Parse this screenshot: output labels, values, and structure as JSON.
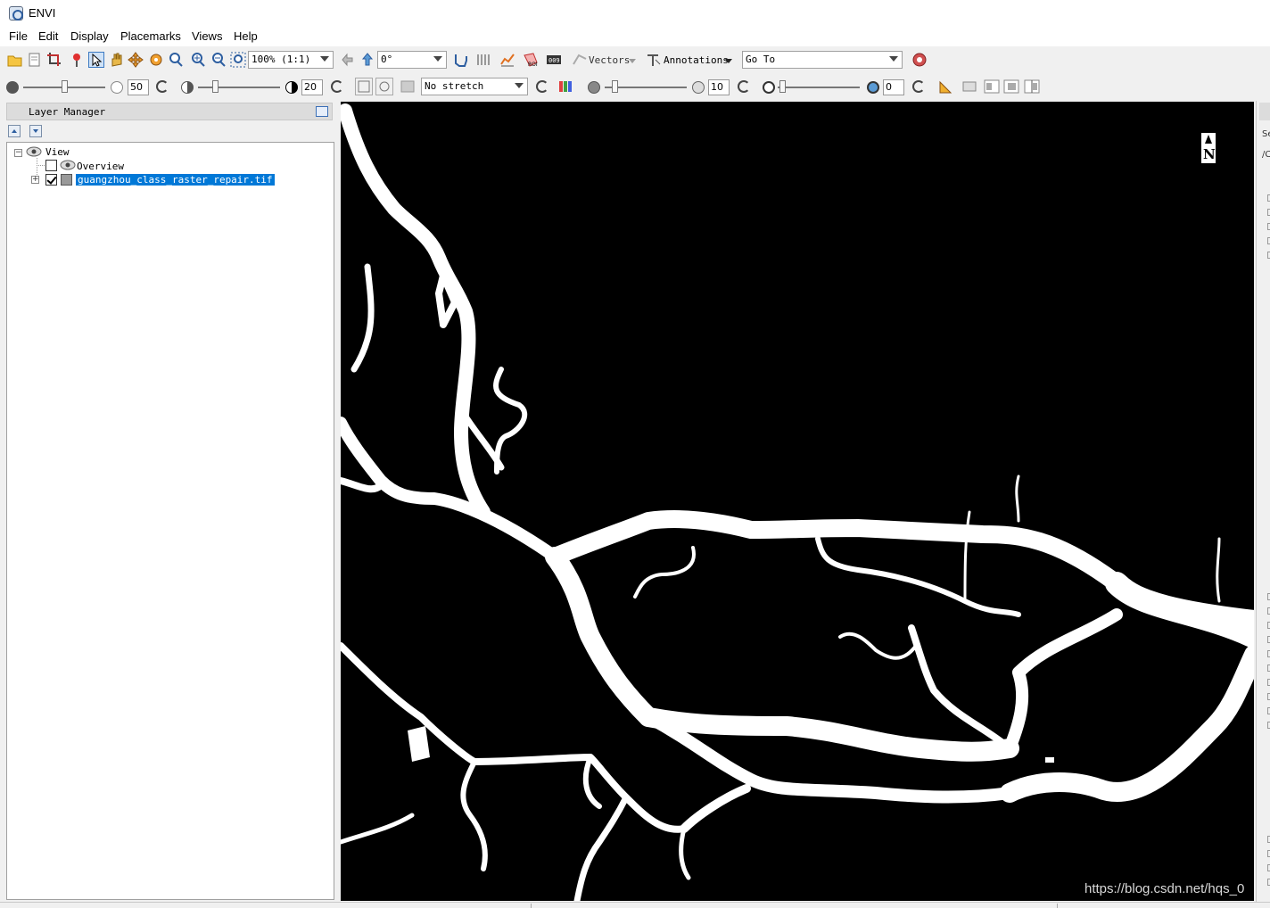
{
  "window": {
    "title": "ENVI"
  },
  "menu": {
    "file": "File",
    "edit": "Edit",
    "display": "Display",
    "placemarks": "Placemarks",
    "views": "Views",
    "help": "Help"
  },
  "toolbar1": {
    "zoom_value": "100% (1:1)",
    "rotation_value": "0°",
    "vectors_label": "Vectors",
    "annotations_label": "Annotations",
    "goto_placeholder": "Go To"
  },
  "toolbar2": {
    "brightness_value": "50",
    "contrast_value": "20",
    "stretch_value": "No stretch",
    "sharpen_value": "10",
    "transparency_value": "0"
  },
  "layer_manager": {
    "title": "Layer Manager",
    "tree": {
      "view": "View",
      "overview": "Overview",
      "layer": "guangzhou_class_raster_repair.tif"
    }
  },
  "right_panel": {
    "partial_labels": [
      "Se",
      "/C"
    ]
  },
  "watermark": "https://blog.csdn.net/hqs_0"
}
